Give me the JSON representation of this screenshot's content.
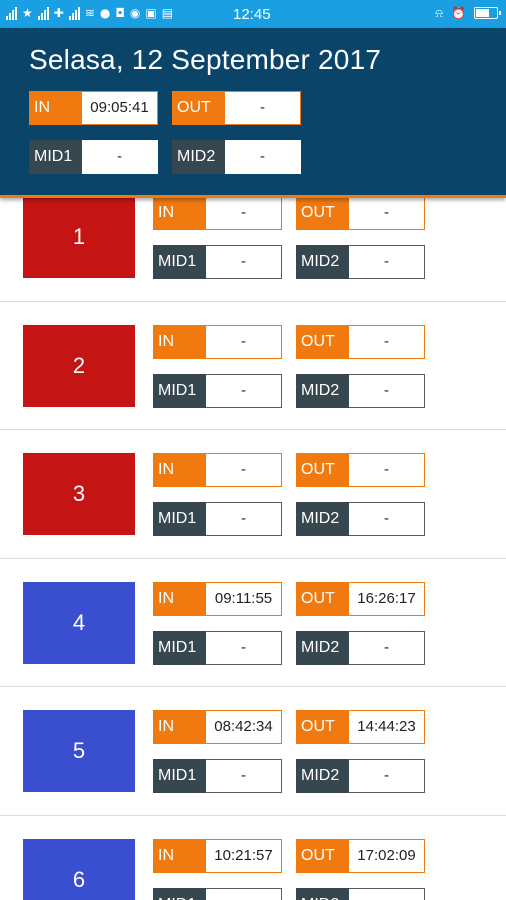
{
  "status_bar": {
    "time": "12:45",
    "left_icons": [
      "signal-icon",
      "star-icon",
      "signal-icon",
      "pin-icon",
      "signal-icon",
      "wifi-icon",
      "messenger-icon",
      "instagram-icon",
      "whatsapp-icon",
      "facebook-icon",
      "chat-icon"
    ],
    "right_icons": [
      "notification-icon",
      "alarm-icon",
      "battery-icon"
    ]
  },
  "header": {
    "date": "Selasa, 12 September 2017",
    "in_label": "IN",
    "in_value": "09:05:41",
    "out_label": "OUT",
    "out_value": "-",
    "mid1_label": "MID1",
    "mid1_value": "-",
    "mid2_label": "MID2",
    "mid2_value": "-"
  },
  "colors": {
    "header_bg": "#0a4468",
    "accent": "#f07a10",
    "status_bar": "#1aa0e2",
    "day_absent": "#c41514",
    "day_present": "#3a4fcf",
    "label_dark": "#37474f"
  },
  "days": [
    {
      "day": "1",
      "status": "red",
      "in": "-",
      "out": "-",
      "mid1": "-",
      "mid2": "-"
    },
    {
      "day": "2",
      "status": "red",
      "in": "-",
      "out": "-",
      "mid1": "-",
      "mid2": "-"
    },
    {
      "day": "3",
      "status": "red",
      "in": "-",
      "out": "-",
      "mid1": "-",
      "mid2": "-"
    },
    {
      "day": "4",
      "status": "blue",
      "in": "09:11:55",
      "out": "16:26:17",
      "mid1": "-",
      "mid2": "-"
    },
    {
      "day": "5",
      "status": "blue",
      "in": "08:42:34",
      "out": "14:44:23",
      "mid1": "-",
      "mid2": "-"
    },
    {
      "day": "6",
      "status": "blue",
      "in": "10:21:57",
      "out": "17:02:09",
      "mid1": "",
      "mid2": ""
    }
  ],
  "labels": {
    "in": "IN",
    "out": "OUT",
    "mid1": "MID1",
    "mid2": "MID2"
  }
}
